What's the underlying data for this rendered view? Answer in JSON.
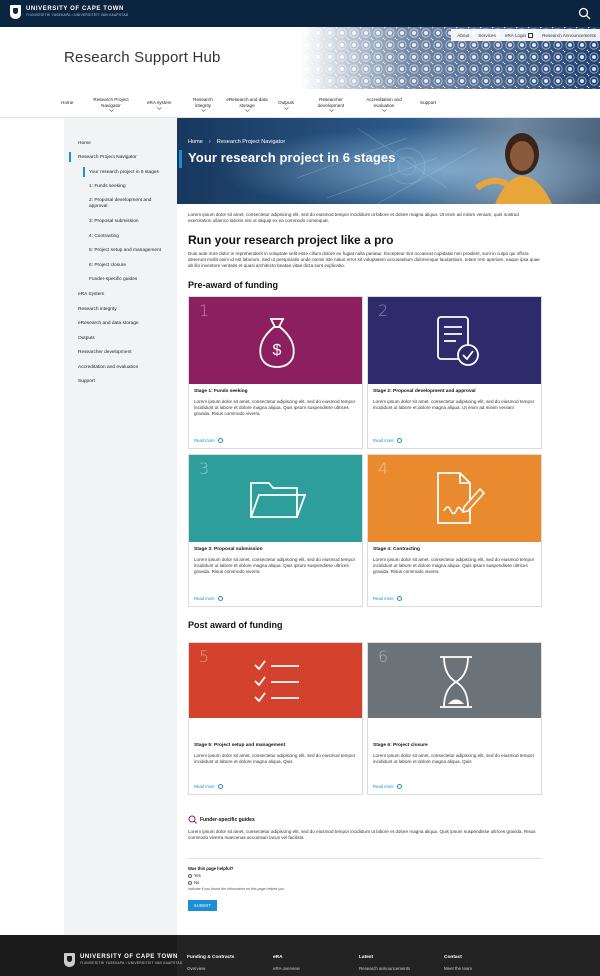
{
  "brand": {
    "name": "UNIVERSITY OF CAPE TOWN",
    "subline": "IYUNIVESITHI YASEKAPA • UNIVERSITEIT VAN KAAPSTAD"
  },
  "header": {
    "title": "Research Support Hub",
    "utility": [
      "About",
      "Services",
      "eRA Login",
      "Research Announcements"
    ]
  },
  "nav": [
    "Home",
    "Research Project Navigator",
    "eRA system",
    "Research integrity",
    "eResearch and data storage",
    "Outputs",
    "Researcher development",
    "Accreditation and evaluation",
    "Support"
  ],
  "sidebar": {
    "items": [
      "Home",
      "Research Project Navigator",
      "Your research project in 6 stages",
      "1: Funds seeking",
      "2: Proposal development and approval",
      "3: Proposal submission",
      "4: Contracting",
      "5: Project setup and management",
      "6: Project closure",
      "Funder-specific guides",
      "eRA System",
      "Research integrity",
      "eResearch and data storage",
      "Outputs",
      "Researcher development",
      "Accreditation and evaluation",
      "Support"
    ]
  },
  "hero": {
    "crumb_home": "Home",
    "crumb_sep": "›",
    "crumb_current": "Research Project Navigator",
    "title": "Your research project in 6 stages"
  },
  "intro": "Lorem ipsum dolor sit amet, consectetur adipiscing elit, sed do eiusmod tempor incididunt ut labore et dolore magna aliqua. Ut enim ad minim veniam, quis nostrud exercitation ullamco laboris nisi ut aliquip ex ea commodo consequat.",
  "section_main": {
    "heading": "Run your research project like a pro",
    "body": "Duis aute irure dolor in reprehenderit in voluptate velit esse cillum dolore eu fugiat nulla pariatur. Excepteur sint occaecat cupidatat non proident, sunt in culpa qui officia deserunt mollit anim id est laborum. Sed ut perspiciatis unde omnis iste natus error sit voluptatem accusantium doloremque laudantium, totam rem aperiam, eaque ipsa quae ab illo inventore veritatis et quasi architecto beatae vitae dicta sunt explicabo."
  },
  "pre_award": {
    "heading": "Pre-award of funding",
    "cards": [
      {
        "num": "1",
        "icon": "money-bag-icon",
        "color": "#8c1f5f",
        "title": "Stage 1: Funds seeking",
        "body": "Lorem ipsum dolor sit amet, consectetur adipiscing elit, sed do eiusmod tempor incididunt ut labore et dolore magna aliqua. Quis ipsum suspendisse ultrices gravida. Risus commodo viverra",
        "more": "Read more"
      },
      {
        "num": "2",
        "icon": "document-check-icon",
        "color": "#2e2a6b",
        "title": "Stage 2: Proposal development and approval",
        "body": "Lorem ipsum dolor sit amet, consectetur adipiscing elit, sed do eiusmod tempor incididunt ut labore et dolore magna aliqua. Ut enim ad minim veniam",
        "more": "Read more"
      },
      {
        "num": "3",
        "icon": "folder-icon",
        "color": "#2e9e9a",
        "title": "Stage 3: Proposal submission",
        "body": "Lorem ipsum dolor sit amet, consectetur adipiscing elit, sed do eiusmod tempor incididunt ut labore et dolore magna aliqua. Quis ipsum suspendisse ultrices gravida. Risus commodo viverra",
        "more": "Read more"
      },
      {
        "num": "4",
        "icon": "signed-document-icon",
        "color": "#e98a2e",
        "title": "Stage 4: Contracting",
        "body": "Lorem ipsum dolor sit amet, consectetur adipiscing elit, sed do eiusmod tempor incididunt ut labore et dolore magna aliqua. Quis ipsum suspendisse ultrices gravida. Risus commodo viverra",
        "more": "Read more"
      }
    ]
  },
  "post_award": {
    "heading": "Post award of funding",
    "cards": [
      {
        "num": "5",
        "icon": "checklist-icon",
        "color": "#d4412c",
        "title": "Stage 5: Project setup and management",
        "body": "Lorem ipsum dolor sit amet, consectetur adipiscing elit, sed do eiusmod tempor incididunt ut labore et dolore magna aliqua. Quis",
        "more": "Read more"
      },
      {
        "num": "6",
        "icon": "hourglass-icon",
        "color": "#6b7378",
        "title": "Stage 6: Project closure",
        "body": "Lorem ipsum dolor sit amet, consectetur adipiscing elit, sed do eiusmod tempor incididunt ut labore et dolore magna aliqua. Quis",
        "more": "Read more"
      }
    ]
  },
  "funder": {
    "label": "Funder-specific guides",
    "body": "Lorem ipsum dolor sit amet, consectetur adipiscing elit, sed do eiusmod tempor incididunt ut labore et dolore magna aliqua. Quis ipsum suspendisse ultrices gravida. Risus commodo viverra maecenas accumsan lacus vel facilisis."
  },
  "feedback": {
    "question": "Was this page helpful?",
    "yes": "Yes",
    "no": "No",
    "hint": "Indicate if you found the information on this page helped you.",
    "submit": "SUBMIT"
  },
  "footer": {
    "cols": [
      {
        "heading": "Funding & Contracts",
        "link": "Overview"
      },
      {
        "heading": "eRA",
        "link": "eRA overview"
      },
      {
        "heading": "Latest",
        "link": "Research announcements"
      },
      {
        "heading": "Contact",
        "link": "Meet the team"
      }
    ]
  },
  "colors": {
    "navy": "#0b2440",
    "accent": "#1a8fd6"
  }
}
